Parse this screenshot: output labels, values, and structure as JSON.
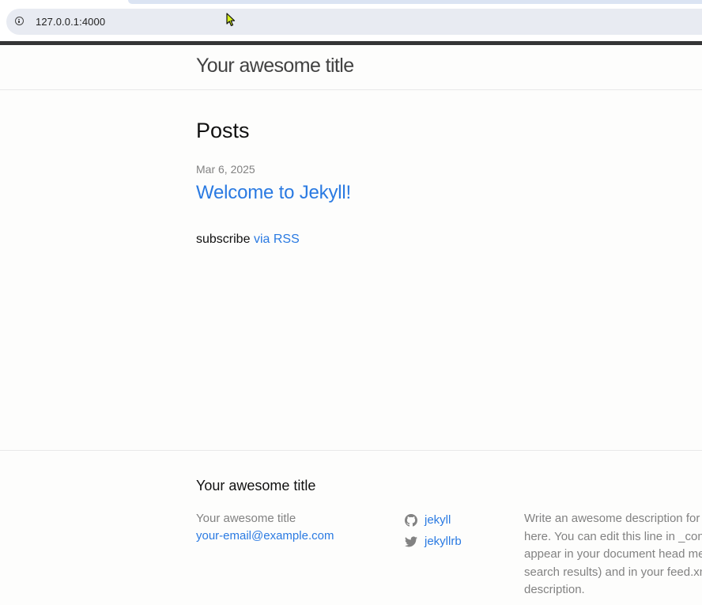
{
  "browser": {
    "url": "127.0.0.1:4000"
  },
  "site": {
    "title": "Your awesome title"
  },
  "main": {
    "heading": "Posts",
    "posts": [
      {
        "date": "Mar 6, 2025",
        "title": "Welcome to Jekyll!"
      }
    ],
    "subscribe_text": "subscribe",
    "subscribe_link": "via RSS"
  },
  "footer": {
    "heading": "Your awesome title",
    "name": "Your awesome title",
    "email": "your-email@example.com",
    "social": [
      {
        "icon": "github-icon",
        "label": "jekyll"
      },
      {
        "icon": "twitter-icon",
        "label": "jekyllrb"
      }
    ],
    "description_lines": [
      "Write an awesome description for",
      "here. You can edit this line in _conf",
      "appear in your document head me",
      "search results) and in your feed.xm",
      "description."
    ]
  },
  "colors": {
    "link": "#2a7ae2",
    "muted": "#828282",
    "background": "#fdfdfc"
  }
}
